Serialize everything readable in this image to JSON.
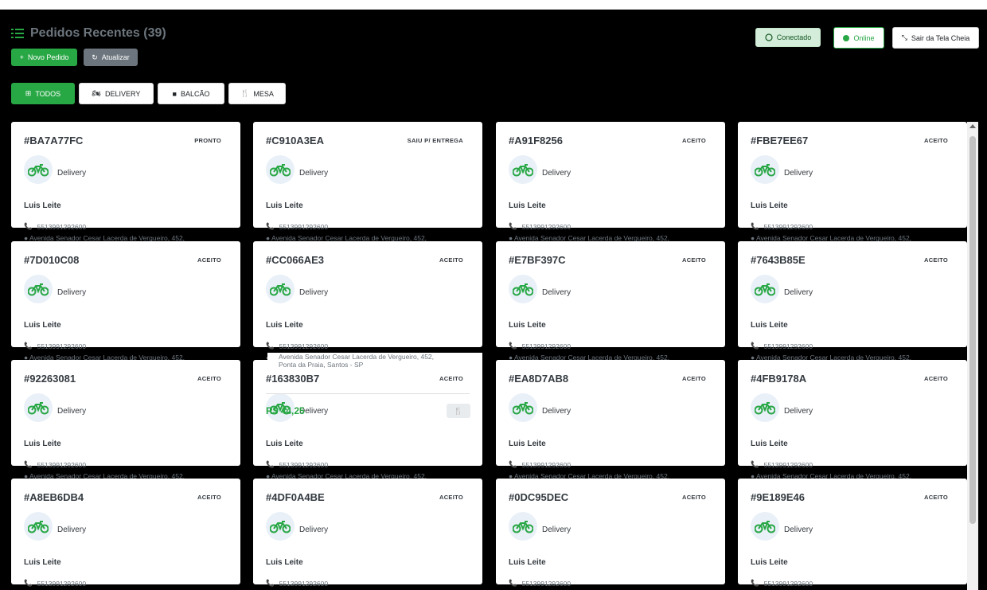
{
  "header": {
    "title": "Pedidos Recentes (39)",
    "new_order": "Novo Pedido",
    "refresh": "Atualizar",
    "whatsapp": "Conectado",
    "online": "Online",
    "exit_fullscreen": "Sair da Tela Cheia"
  },
  "filters": [
    "TODOS",
    "DELIVERY",
    "BALCÃO",
    "MESA"
  ],
  "colors": {
    "accent": "#28a745",
    "background": "#000000"
  },
  "orders": [
    {
      "code": "#BA7A77FC",
      "status": "PRONTO",
      "type": "Delivery",
      "customer": "Luis Leite",
      "phone": "5513991292600",
      "address": "Avenida Senador Cesar Lacerda de Vergueiro, 452,"
    },
    {
      "code": "#C910A3EA",
      "status": "SAIU P/ ENTREGA",
      "type": "Delivery",
      "customer": "Luis Leite",
      "phone": "5513991292600",
      "address": "Avenida Senador Cesar Lacerda de Vergueiro, 452,"
    },
    {
      "code": "#A91F8256",
      "status": "ACEITO",
      "type": "Delivery",
      "customer": "Luis Leite",
      "phone": "5513991292600",
      "address": "Avenida Senador Cesar Lacerda de Vergueiro, 452,"
    },
    {
      "code": "#FBE7EE67",
      "status": "ACEITO",
      "type": "Delivery",
      "customer": "Luis Leite",
      "phone": "5513991292600",
      "address": "Avenida Senador Cesar Lacerda de Vergueiro, 452,"
    },
    {
      "code": "#7D010C08",
      "status": "ACEITO",
      "type": "Delivery",
      "customer": "Luis Leite",
      "phone": "5513991292600",
      "address": "Avenida Senador Cesar Lacerda de Vergueiro, 452,"
    },
    {
      "code": "#CC066AE3",
      "status": "ACEITO",
      "type": "Delivery",
      "customer": "Luis Leite",
      "phone": "5513991292600",
      "address": "Avenida Senador Cesar Lacerda de Vergueiro, 452,"
    },
    {
      "code": "#E7BF397C",
      "status": "ACEITO",
      "type": "Delivery",
      "customer": "Luis Leite",
      "phone": "5513991292600",
      "address": "Avenida Senador Cesar Lacerda de Vergueiro, 452,"
    },
    {
      "code": "#7643B85E",
      "status": "ACEITO",
      "type": "Delivery",
      "customer": "Luis Leite",
      "phone": "5513991292600",
      "address": "Avenida Senador Cesar Lacerda de Vergueiro, 452,"
    },
    {
      "code": "#92263081",
      "status": "ACEITO",
      "type": "Delivery",
      "customer": "Luis Leite",
      "phone": "5513991292600",
      "address": "Avenida Senador Cesar Lacerda de Vergueiro, 452,"
    },
    {
      "code": "#163830B7",
      "status": "ACEITO",
      "type": "Delivery",
      "customer": "Luis Leite",
      "phone": "5513991292600",
      "address": "Avenida Senador Cesar Lacerda de Vergueiro, 452,"
    },
    {
      "code": "#EA8D7AB8",
      "status": "ACEITO",
      "type": "Delivery",
      "customer": "Luis Leite",
      "phone": "5513991292600",
      "address": "Avenida Senador Cesar Lacerda de Vergueiro, 452,"
    },
    {
      "code": "#4FB9178A",
      "status": "ACEITO",
      "type": "Delivery",
      "customer": "Luis Leite",
      "phone": "5513991292600",
      "address": "Avenida Senador Cesar Lacerda de Vergueiro, 452,"
    },
    {
      "code": "#A8EB6DB4",
      "status": "ACEITO",
      "type": "Delivery",
      "customer": "Luis Leite",
      "phone": "5513991292600",
      "address": ""
    },
    {
      "code": "#4DF0A4BE",
      "status": "ACEITO",
      "type": "Delivery",
      "customer": "Luis Leite",
      "phone": "5513991292600",
      "address": ""
    },
    {
      "code": "#0DC95DEC",
      "status": "ACEITO",
      "type": "Delivery",
      "customer": "Luis Leite",
      "phone": "5513991292600",
      "address": ""
    },
    {
      "code": "#9E189E46",
      "status": "ACEITO",
      "type": "Delivery",
      "customer": "Luis Leite",
      "phone": "5513991292600",
      "address": ""
    }
  ],
  "overlay": {
    "address_line1": "Avenida Senador Cesar Lacerda de Vergueiro, 452,",
    "address_line2": "Ponta da Praia, Santos - SP",
    "price": "R$ 44,25"
  }
}
